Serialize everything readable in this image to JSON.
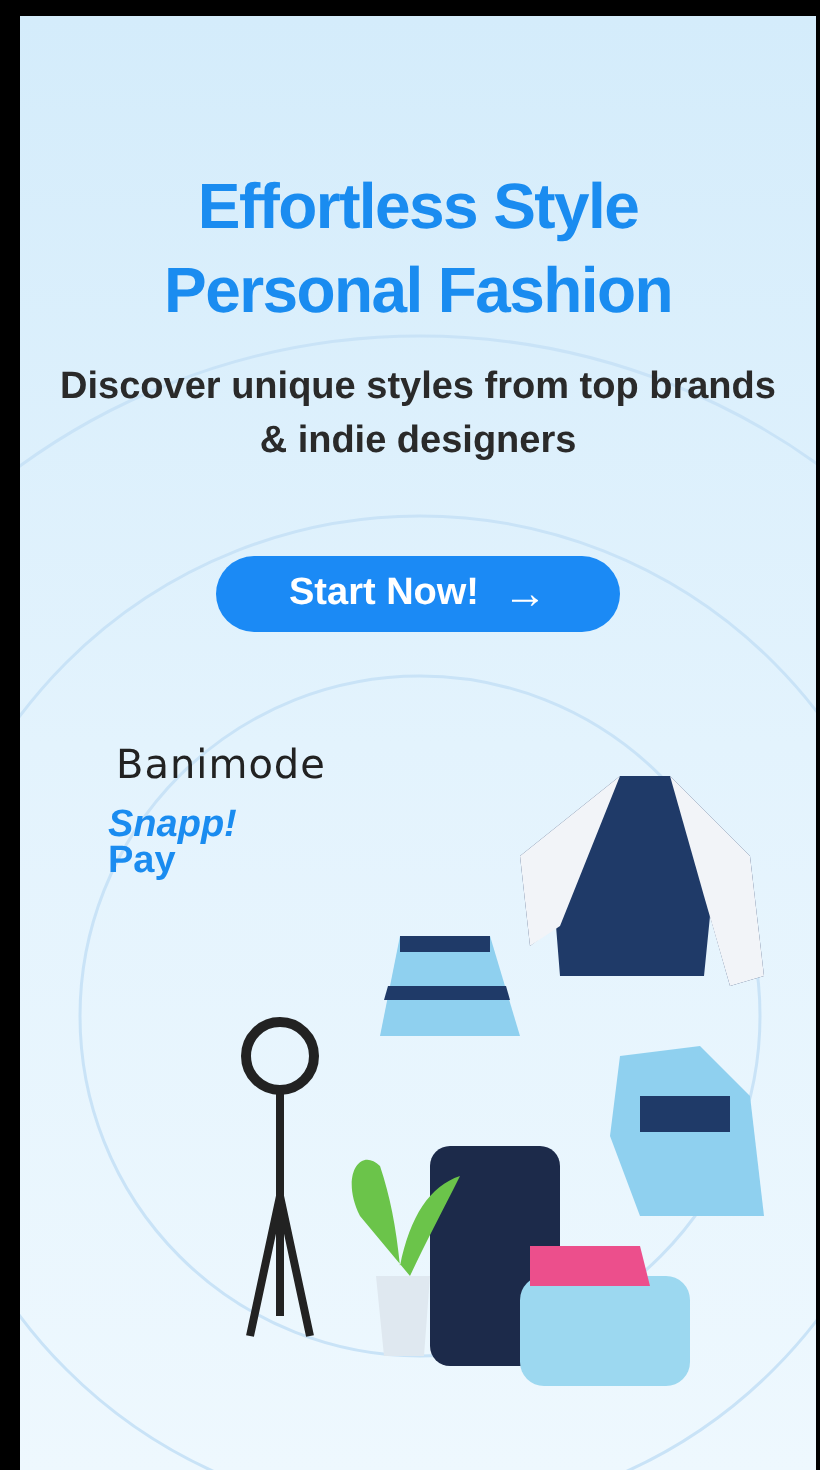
{
  "banner": {
    "title_lines": [
      "Effortless Style",
      "Personal Fashion"
    ],
    "subtitle": "Discover unique styles from top brands & indie designers",
    "cta": {
      "label": "Start Now!",
      "arrow": "→"
    },
    "logos": [
      {
        "kind": "banimode",
        "text": "Banimode"
      },
      {
        "kind": "snapp",
        "text": "Snapp!",
        "text2": "Pay"
      }
    ]
  }
}
